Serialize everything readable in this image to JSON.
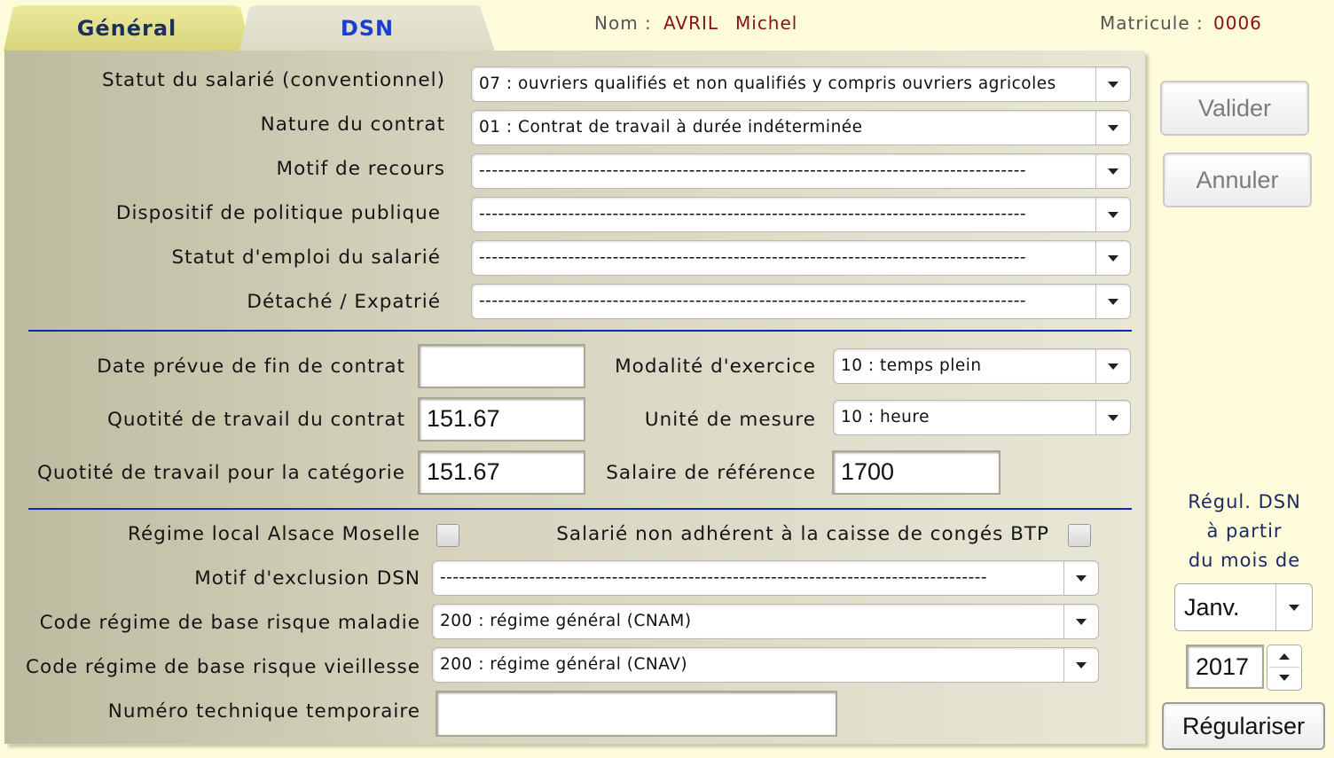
{
  "tabs": [
    {
      "label": "Général"
    },
    {
      "label": "DSN"
    }
  ],
  "header": {
    "nom_label": "Nom :",
    "nom_last": "AVRIL",
    "nom_first": "Michel",
    "matricule_label": "Matricule :",
    "matricule_value": "0006"
  },
  "form": {
    "statut_salarie": {
      "label": "Statut du salarié (conventionnel)",
      "value": "07 : ouvriers qualifiés et non qualifiés y compris ouvriers agricoles"
    },
    "nature_contrat": {
      "label": "Nature du contrat",
      "value": "01 : Contrat de travail à durée indéterminée"
    },
    "motif_recours": {
      "label": "Motif de recours",
      "value": "--------------------------------------------------------------------------------------"
    },
    "dispositif": {
      "label": "Dispositif de politique publique",
      "value": "--------------------------------------------------------------------------------------"
    },
    "statut_emploi": {
      "label": "Statut d'emploi du salarié",
      "value": "--------------------------------------------------------------------------------------"
    },
    "detache": {
      "label": "Détaché / Expatrié",
      "value": "--------------------------------------------------------------------------------------"
    },
    "date_fin": {
      "label": "Date prévue de fin de contrat",
      "value": ""
    },
    "quotite_contrat": {
      "label": "Quotité de travail du contrat",
      "value": "151.67"
    },
    "quotite_categorie": {
      "label": "Quotité de travail pour la catégorie",
      "value": "151.67"
    },
    "modalite": {
      "label": "Modalité d'exercice",
      "value": "10 : temps plein"
    },
    "unite": {
      "label": "Unité de mesure",
      "value": "10 : heure"
    },
    "salaire_ref": {
      "label": "Salaire de référence",
      "value": "1700"
    },
    "alsace": {
      "label": "Régime local Alsace Moselle",
      "checked": false
    },
    "btp": {
      "label": "Salarié non adhérent à la caisse de congés BTP",
      "checked": false
    },
    "motif_exclusion": {
      "label": "Motif d'exclusion DSN",
      "value": "--------------------------------------------------------------------------------------"
    },
    "regime_maladie": {
      "label": "Code régime de base risque maladie",
      "value": "200 : régime général (CNAM)"
    },
    "regime_vieillesse": {
      "label": "Code régime de base risque vieillesse",
      "value": "200 : régime général (CNAV)"
    },
    "numero_technique": {
      "label": "Numéro technique temporaire",
      "value": ""
    }
  },
  "side": {
    "valider": "Valider",
    "annuler": "Annuler",
    "regul_line1": "Régul. DSN",
    "regul_line2": "à partir",
    "regul_line3": "du mois de",
    "month": "Janv.",
    "year": "2017",
    "regulariser": "Régulariser"
  },
  "colors": {
    "background": "#fdfbd9",
    "tab_general": "#d7d47c",
    "tab_dsn_text": "#1a3fd0",
    "separator": "#1125b8",
    "value_red": "#8b1010"
  }
}
